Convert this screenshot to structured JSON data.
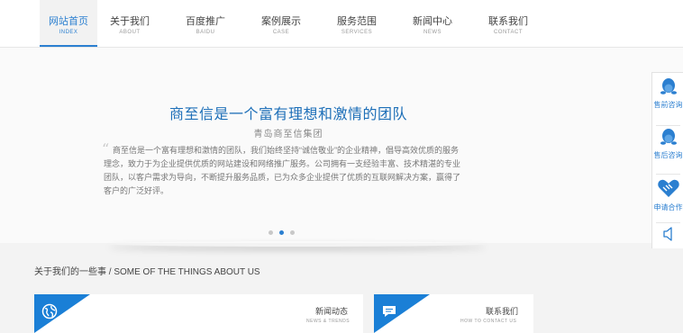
{
  "nav": {
    "items": [
      {
        "label": "网站首页",
        "en": "INDEX",
        "active": true
      },
      {
        "label": "关于我们",
        "en": "ABOUT"
      },
      {
        "label": "百度推广",
        "en": "BAIDU"
      },
      {
        "label": "案例展示",
        "en": "CASE"
      },
      {
        "label": "服务范围",
        "en": "SERVICES"
      },
      {
        "label": "新闻中心",
        "en": "NEWS"
      },
      {
        "label": "联系我们",
        "en": "CONTACT"
      }
    ]
  },
  "hero": {
    "title": "商至信是一个富有理想和激情的团队",
    "subtitle": "青岛商至信集团",
    "quote_mark": "“",
    "body": "商至信是一个富有理想和激情的团队，我们始终坚持“诚信敬业”的企业精神，倡导高效优质的服务理念，致力于为企业提供优质的网站建设和网络推广服务。公司拥有一支经验丰富、技术精湛的专业团队，以客户需求为导向，不断提升服务品质，已为众多企业提供了优质的互联网解决方案，赢得了客户的广泛好评。",
    "slides": 3,
    "active_slide": 1
  },
  "sidebar": {
    "items": [
      {
        "label": "售前咨询",
        "icon": "qq-penguin-icon"
      },
      {
        "label": "售后咨询",
        "icon": "qq-penguin-icon"
      },
      {
        "label": "申请合作",
        "icon": "handshake-icon"
      },
      {
        "label": "",
        "icon": "speaker-icon"
      }
    ]
  },
  "section": {
    "title": "关于我们的一些事 / SOME OF THE THINGS ABOUT US"
  },
  "cards": [
    {
      "title": "新闻动态",
      "subtitle": "NEWS & TRENDS",
      "icon": "globe-icon"
    },
    {
      "title": "联系我们",
      "subtitle": "HOW TO CONTACT US",
      "icon": "chat-bubble-icon"
    }
  ],
  "colors": {
    "accent": "#2b7fd0",
    "card_accent": "#1a7fd6",
    "title": "#1d6fb8"
  }
}
